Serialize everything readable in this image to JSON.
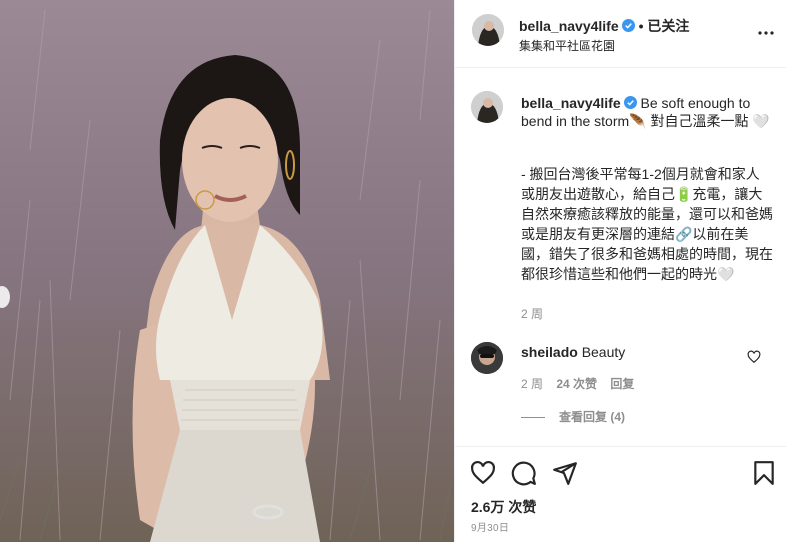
{
  "header": {
    "username": "bella_navy4life",
    "separator": "•",
    "follow_status": "已关注",
    "location": "集集和平社區花園",
    "more_icon": "more-horizontal-icon"
  },
  "caption": {
    "username": "bella_navy4life",
    "headline": "Be soft enough to bend in the storm🪶 對自己溫柔一點 🤍",
    "body": "- 搬回台灣後平常每1-2個月就會和家人或朋友出遊散心，給自己🔋充電，讓大自然來療癒該釋放的能量，還可以和爸媽或是朋友有更深層的連結🔗以前在美國，錯失了很多和爸媽相處的時間，現在都很珍惜這些和他們一起的時光🤍",
    "time": "2 周"
  },
  "comment": {
    "username": "sheilado",
    "text": "Beauty",
    "time": "2 周",
    "likes": "24 次赞",
    "reply": "回复",
    "view_replies": "查看回复 (4)"
  },
  "actions": {
    "like_icon": "heart-icon",
    "comment_icon": "comment-icon",
    "share_icon": "paper-plane-icon",
    "save_icon": "bookmark-icon"
  },
  "likes_count": "2.6万 次赞",
  "date": "9月30日",
  "colors": {
    "verified": "#3897f0",
    "muted": "#8e8e8e",
    "text": "#262626",
    "border": "#efefef"
  }
}
